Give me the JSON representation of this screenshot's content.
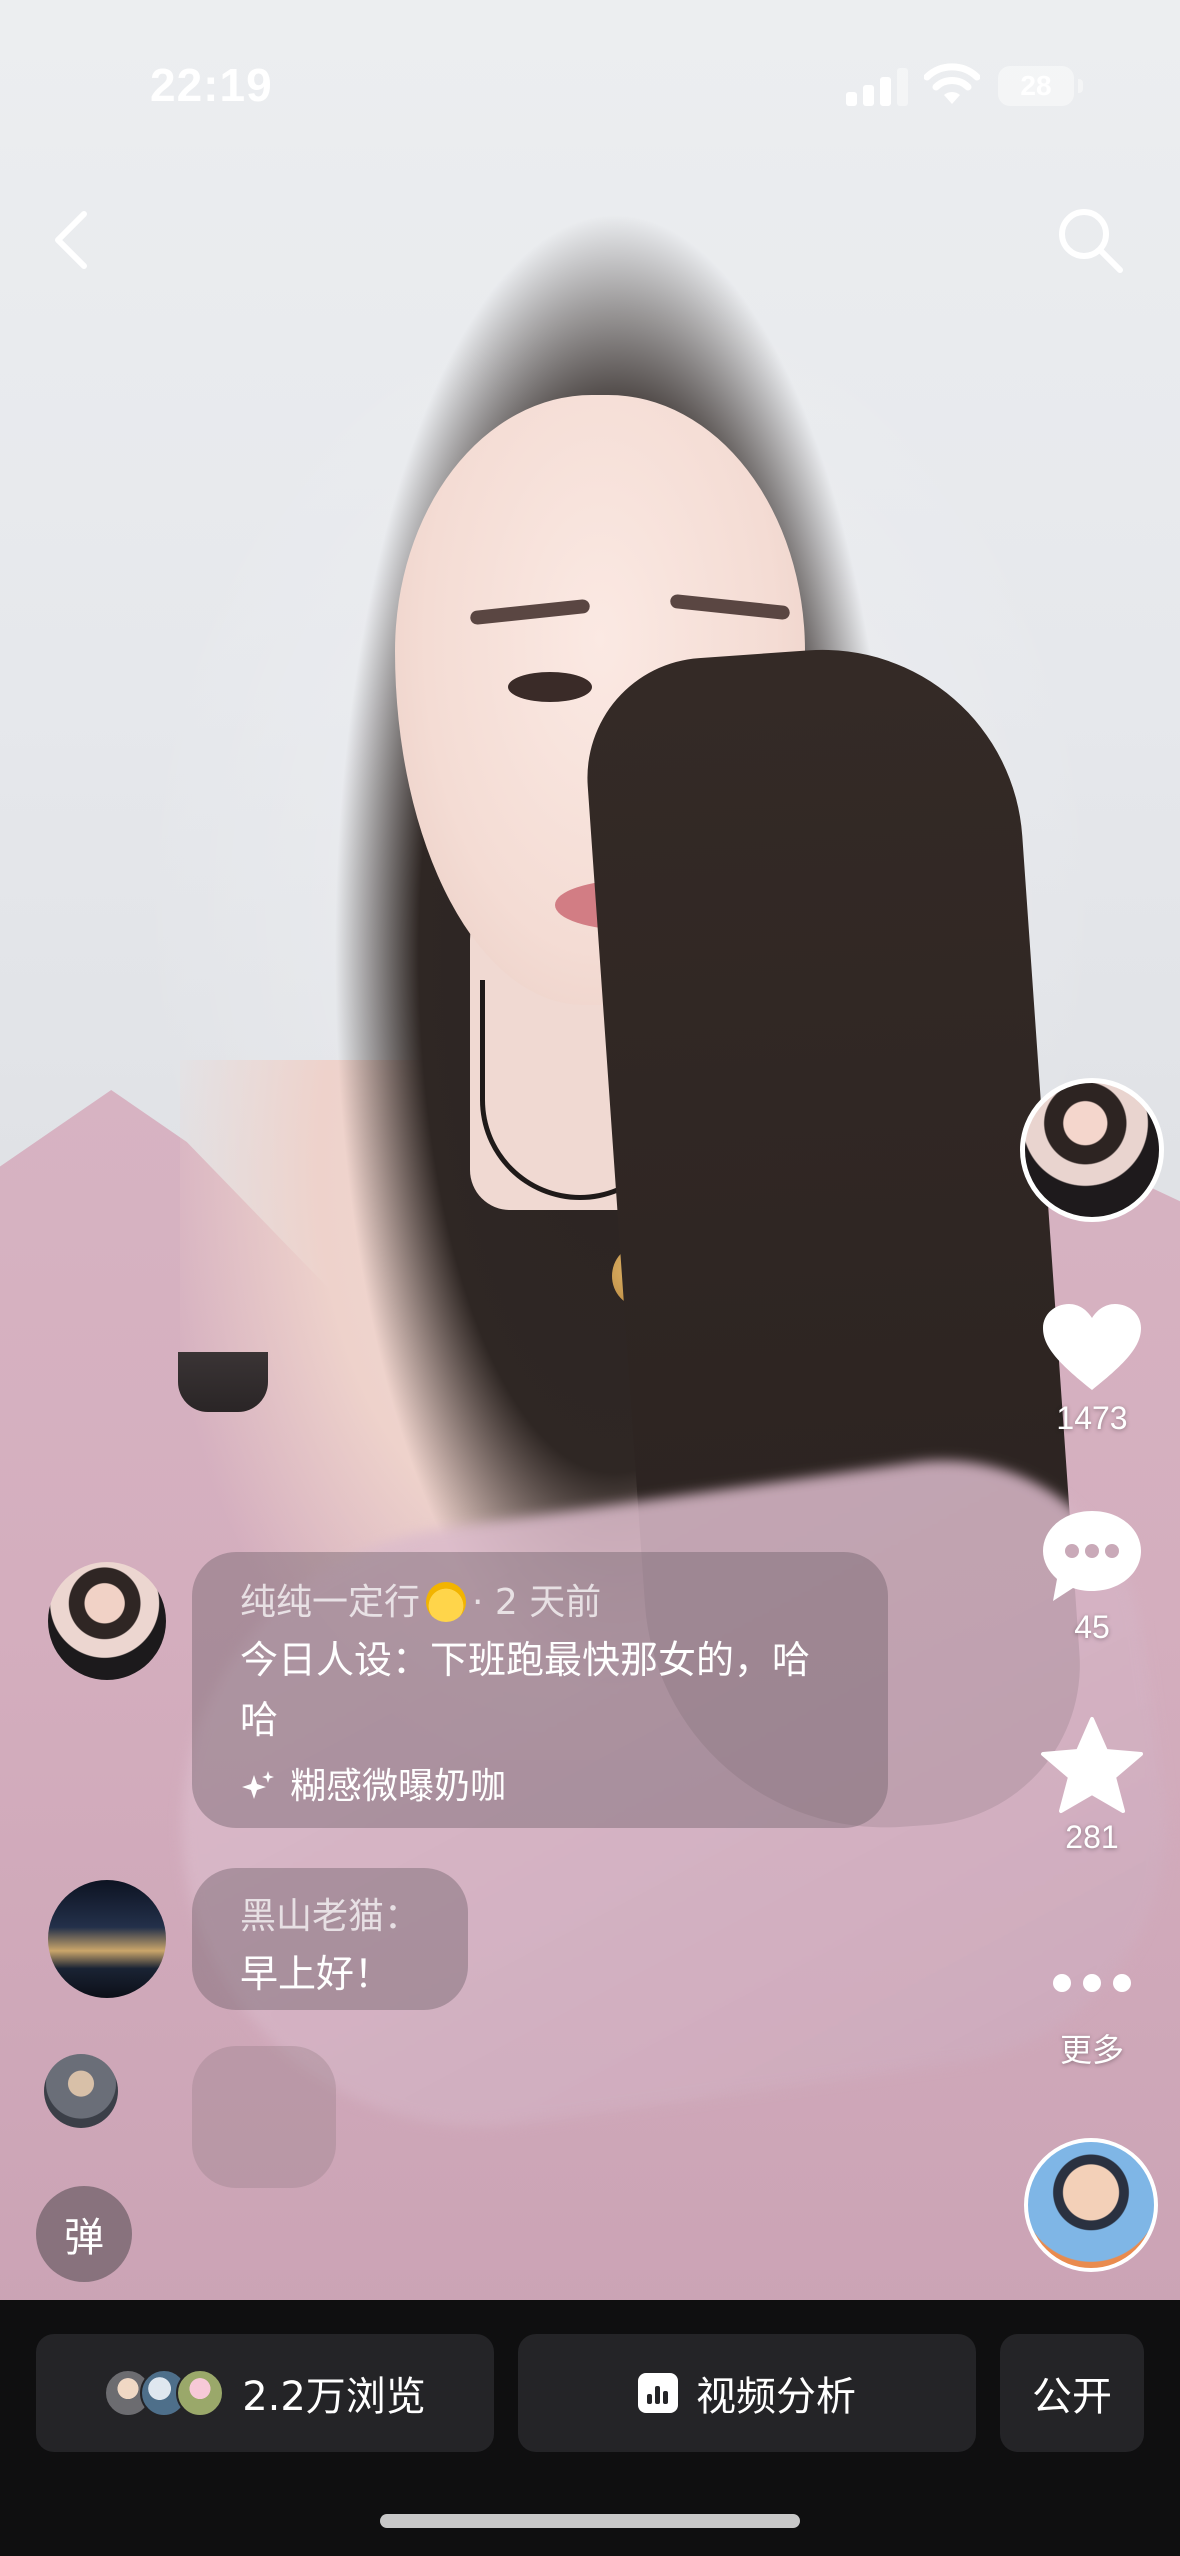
{
  "status_bar": {
    "time": "22:19",
    "battery": "28"
  },
  "nav": {
    "back_icon": "chevron-left-icon",
    "search_icon": "search-icon"
  },
  "right_rail": {
    "like_count": "1473",
    "comment_count": "45",
    "favorite_count": "281",
    "more_label": "更多"
  },
  "comments": [
    {
      "author": "纯纯一定行",
      "author_emoji": "chick-icon",
      "time": "· 2 天前",
      "text": "今日人设：下班跑最快那女的，哈哈",
      "tag": "糊感微曝奶咖"
    },
    {
      "author": "黑山老猫：",
      "text": "早上好！"
    }
  ],
  "danmu_button": "弹",
  "bottom_bar": {
    "views_label": "2.2万浏览",
    "analysis_label": "视频分析",
    "visibility_label": "公开"
  },
  "colors": {
    "bottom_bar_bg": "#0f0f10",
    "pill_bg": "#242427",
    "bubble_bg": "rgba(110,96,104,0.42)"
  }
}
